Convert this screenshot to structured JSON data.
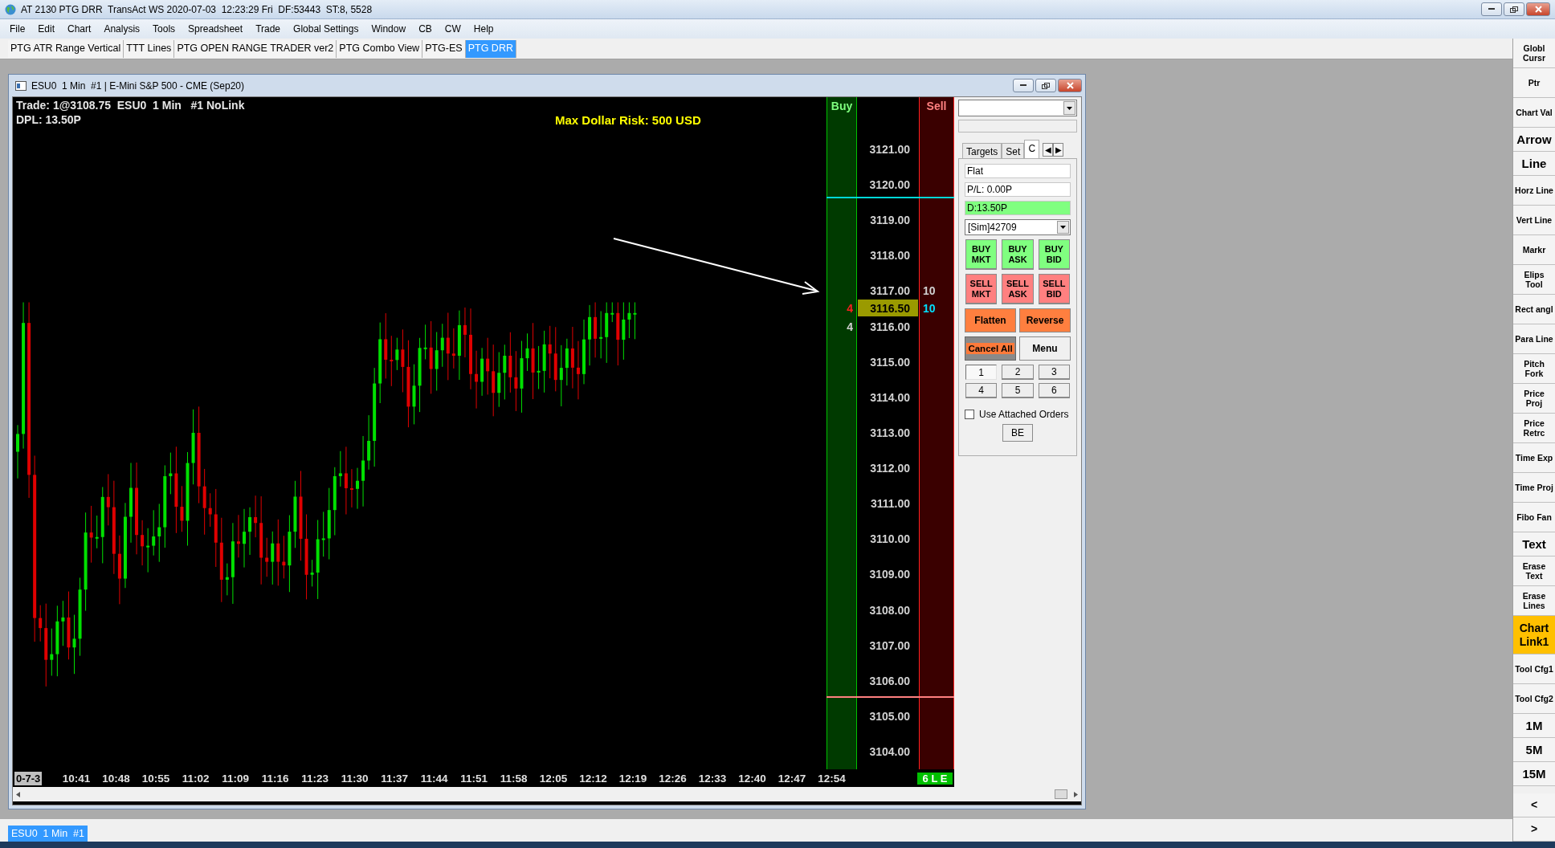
{
  "title_bar": {
    "title": "AT 2130 PTG DRR  TransAct WS 2020-07-03  12:23:29 Fri  DF:53443  ST:8, 5528"
  },
  "menu": [
    "File",
    "Edit",
    "Chart",
    "Analysis",
    "Tools",
    "Spreadsheet",
    "Trade",
    "Global Settings",
    "Window",
    "CB",
    "CW",
    "Help"
  ],
  "tabs": [
    {
      "label": "PTG ATR Range Vertical",
      "selected": false
    },
    {
      "label": "TTT Lines",
      "selected": false
    },
    {
      "label": "PTG OPEN RANGE TRADER ver2",
      "selected": false
    },
    {
      "label": "PTG Combo View",
      "selected": false
    },
    {
      "label": "PTG-ES",
      "selected": false
    },
    {
      "label": "PTG DRR",
      "selected": true
    }
  ],
  "chart_window": {
    "title": "ESU0  1 Min  #1 | E-Mini S&P 500 - CME (Sep20)",
    "info_lines": [
      "Trade: 1@3108.75  ESU0  1 Min   #1 NoLink",
      "DPL: 13.50P"
    ],
    "risk_text": "Max Dollar Risk: 500 USD",
    "date_label": "0-7-3",
    "time_labels": [
      "10:41",
      "10:48",
      "10:55",
      "11:02",
      "11:09",
      "11:16",
      "11:23",
      "11:30",
      "11:37",
      "11:44",
      "11:51",
      "11:58",
      "12:05",
      "12:12",
      "12:19",
      "12:26",
      "12:33",
      "12:40",
      "12:47",
      "12:54"
    ],
    "ladder": {
      "buy_label": "Buy",
      "sell_label": "Sell",
      "status": "6 L E",
      "rows": [
        {
          "price": "3121.00"
        },
        {
          "price": "3120.00"
        },
        {
          "price": "3119.00"
        },
        {
          "price": "3118.00"
        },
        {
          "price": "3117.00",
          "sell_qty": "10",
          "last": {
            "price": "3116.50",
            "bid_qty": "4",
            "ask_qty": "10"
          }
        },
        {
          "price": "3116.00",
          "buy_qty": "4"
        },
        {
          "price": "3115.00"
        },
        {
          "price": "3114.00"
        },
        {
          "price": "3113.00"
        },
        {
          "price": "3112.00"
        },
        {
          "price": "3111.00"
        },
        {
          "price": "3110.00"
        },
        {
          "price": "3109.00"
        },
        {
          "price": "3108.00"
        },
        {
          "price": "3107.00"
        },
        {
          "price": "3106.00"
        },
        {
          "price": "3105.00"
        },
        {
          "price": "3104.00"
        }
      ]
    },
    "trade_panel": {
      "subtabs": [
        {
          "label": "Targets",
          "selected": false
        },
        {
          "label": "Set",
          "selected": false
        },
        {
          "label": "C",
          "selected": true
        }
      ],
      "nav_arrows": [
        "◀",
        "▶"
      ],
      "position": "Flat",
      "pl": "P/L: 0.00P",
      "dpl": "D:13.50P",
      "account": "[Sim]42709",
      "buy_buttons": [
        "BUY MKT",
        "BUY ASK",
        "BUY BID"
      ],
      "sell_buttons": [
        "SELL MKT",
        "SELL ASK",
        "SELL BID"
      ],
      "flatten": "Flatten",
      "reverse": "Reverse",
      "cancel_all": "Cancel All",
      "menu": "Menu",
      "quantities": [
        {
          "label": "1",
          "selected": true
        },
        {
          "label": "2",
          "selected": false
        },
        {
          "label": "3",
          "selected": false
        },
        {
          "label": "4",
          "selected": false
        },
        {
          "label": "5",
          "selected": false
        },
        {
          "label": "6",
          "selected": false
        }
      ],
      "attached_orders": {
        "label": "Use Attached Orders",
        "checked": false
      },
      "be": "BE"
    }
  },
  "bottom_tab": "ESU0  1 Min  #1",
  "toolbar": [
    {
      "label": "Globl Cursr",
      "kind": "small",
      "selected": false
    },
    {
      "label": "Ptr",
      "kind": "small",
      "selected": false
    },
    {
      "label": "Chart Val",
      "kind": "small",
      "selected": false
    },
    {
      "label": "Arrow",
      "kind": "large",
      "selected": false
    },
    {
      "label": "Line",
      "kind": "large",
      "selected": false
    },
    {
      "label": "Horz Line",
      "kind": "small",
      "selected": false
    },
    {
      "label": "Vert Line",
      "kind": "small",
      "selected": false
    },
    {
      "label": "Markr",
      "kind": "small",
      "selected": false
    },
    {
      "label": "Elips Tool",
      "kind": "small",
      "selected": false
    },
    {
      "label": "Rect angl",
      "kind": "small",
      "selected": false
    },
    {
      "label": "Para Line",
      "kind": "small",
      "selected": false
    },
    {
      "label": "Pitch Fork",
      "kind": "small",
      "selected": false
    },
    {
      "label": "Price Proj",
      "kind": "small",
      "selected": false
    },
    {
      "label": "Price Retrc",
      "kind": "small",
      "selected": false
    },
    {
      "label": "Time Exp",
      "kind": "small",
      "selected": false
    },
    {
      "label": "Time Proj",
      "kind": "small",
      "selected": false
    },
    {
      "label": "Fibo Fan",
      "kind": "small",
      "selected": false
    },
    {
      "label": "Text",
      "kind": "large",
      "selected": false
    },
    {
      "label": "Erase Text",
      "kind": "small",
      "selected": false
    },
    {
      "label": "Erase Lines",
      "kind": "small",
      "selected": false
    },
    {
      "label": "Chart Link1",
      "kind": "large",
      "selected": true
    },
    {
      "label": "Tool Cfg1",
      "kind": "small",
      "selected": false
    },
    {
      "label": "Tool Cfg2",
      "kind": "small",
      "selected": false
    },
    {
      "label": "1M",
      "kind": "large",
      "selected": false
    },
    {
      "label": "5M",
      "kind": "large",
      "selected": false
    },
    {
      "label": "15M",
      "kind": "large",
      "selected": false
    },
    {
      "label": "<",
      "kind": "nav",
      "selected": false
    },
    {
      "label": ">",
      "kind": "nav",
      "selected": false
    }
  ]
}
